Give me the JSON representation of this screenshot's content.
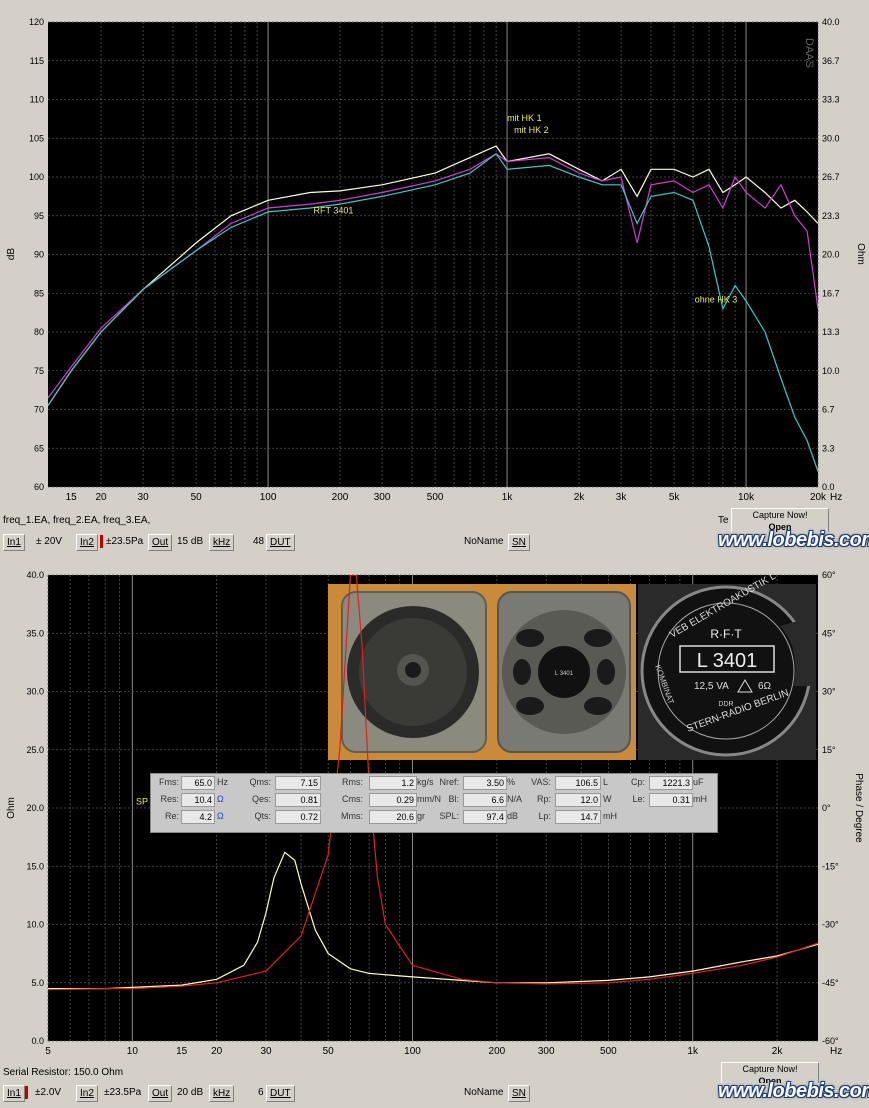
{
  "chart_data": [
    {
      "type": "line",
      "title": "",
      "xlabel": "Hz",
      "ylabel": "dB",
      "ylabel_right": "Ohm",
      "x_scale": "log",
      "xlim": [
        12,
        20000
      ],
      "ylim": [
        60,
        120
      ],
      "yticks": [
        "120",
        "115",
        "110",
        "105",
        "100",
        "95",
        "90",
        "85",
        "80",
        "75",
        "70",
        "65",
        "60"
      ],
      "yticks_right": [
        "40.0",
        "36.7",
        "33.3",
        "30.0",
        "26.7",
        "23.3",
        "20.0",
        "16.7",
        "13.3",
        "10.0",
        "6.7",
        "3.3",
        "0.0"
      ],
      "xtick_labels": [
        {
          "x": 15,
          "label": "15"
        },
        {
          "x": 20,
          "label": "20"
        },
        {
          "x": 30,
          "label": "30"
        },
        {
          "x": 50,
          "label": "50"
        },
        {
          "x": 100,
          "label": "100"
        },
        {
          "x": 200,
          "label": "200"
        },
        {
          "x": 300,
          "label": "300"
        },
        {
          "x": 500,
          "label": "500"
        },
        {
          "x": 1000,
          "label": "1k"
        },
        {
          "x": 2000,
          "label": "2k"
        },
        {
          "x": 3000,
          "label": "3k"
        },
        {
          "x": 5000,
          "label": "5k"
        },
        {
          "x": 10000,
          "label": "10k"
        },
        {
          "x": 20000,
          "label": "20k"
        }
      ],
      "grid": true,
      "watermark": "DAAS",
      "series": [
        {
          "color": "#ffffe0",
          "x": [
            12,
            15,
            20,
            30,
            50,
            70,
            100,
            150,
            200,
            300,
            500,
            700,
            900,
            1000,
            1500,
            2000,
            2500,
            3000,
            3500,
            4000,
            5000,
            6000,
            7000,
            8000,
            9000,
            10000,
            12000,
            14000,
            16000,
            18000,
            20000
          ],
          "y": [
            70.5,
            75,
            80,
            85.5,
            91.5,
            95,
            97,
            98,
            98.2,
            99,
            100.5,
            102.5,
            104,
            102,
            103,
            101,
            99.5,
            101,
            97.5,
            101,
            101,
            100,
            101,
            98,
            99,
            100,
            98,
            96,
            97,
            95.5,
            94
          ]
        },
        {
          "color": "#d040d0",
          "x": [
            12,
            15,
            20,
            30,
            50,
            70,
            100,
            150,
            200,
            300,
            500,
            700,
            900,
            1000,
            1500,
            2000,
            2500,
            3000,
            3500,
            4000,
            5000,
            6000,
            7000,
            8000,
            9000,
            10000,
            12000,
            14000,
            16000,
            18000,
            20000
          ],
          "y": [
            71.5,
            75.5,
            80.5,
            85.5,
            90.5,
            94,
            96,
            96.5,
            97,
            98,
            99.5,
            101,
            103,
            102,
            102.5,
            100.5,
            99.5,
            100,
            91.5,
            99,
            99.5,
            98,
            99,
            96,
            100,
            98,
            96,
            99,
            95,
            93,
            83
          ]
        },
        {
          "color": "#40c8c8",
          "x": [
            12,
            15,
            20,
            30,
            50,
            70,
            100,
            150,
            200,
            300,
            500,
            700,
            900,
            1000,
            1500,
            2000,
            2500,
            3000,
            3500,
            4000,
            5000,
            6000,
            7000,
            8000,
            9000,
            10000,
            12000,
            14000,
            16000,
            18000,
            20000
          ],
          "y": [
            70.5,
            75,
            80,
            85.5,
            90.5,
            93.5,
            95.5,
            96,
            96.5,
            97.5,
            99,
            100.5,
            103,
            101,
            101.5,
            100,
            99,
            99,
            94,
            97.5,
            98,
            97,
            91,
            83,
            86,
            84,
            80,
            74,
            69,
            66,
            62
          ]
        }
      ],
      "annotations": [
        {
          "text": "mit HK 1",
          "x": 1000,
          "y": 107.2
        },
        {
          "text": "mit HK 2",
          "x": 1070,
          "y": 105.7
        },
        {
          "text": "RFT 3401",
          "x": 155,
          "y": 95.3
        },
        {
          "text": "ohne HK 3",
          "x": 6100,
          "y": 83.8
        }
      ]
    },
    {
      "type": "line",
      "title": "",
      "xlabel": "Hz",
      "ylabel": "Ohm",
      "ylabel_right": "Phase / Degree",
      "x_scale": "log",
      "xlim": [
        5,
        2800
      ],
      "ylim": [
        0,
        40
      ],
      "yticks": [
        "40.0",
        "35.0",
        "30.0",
        "25.0",
        "20.0",
        "15.0",
        "10.0",
        "5.0",
        "0.0"
      ],
      "yticks_right": [
        "60°",
        "45°",
        "30°",
        "15°",
        "0°",
        "-15°",
        "-30°",
        "-45°",
        "-60°"
      ],
      "xtick_labels": [
        {
          "x": 5,
          "label": "5"
        },
        {
          "x": 10,
          "label": "10"
        },
        {
          "x": 15,
          "label": "15"
        },
        {
          "x": 20,
          "label": "20"
        },
        {
          "x": 30,
          "label": "30"
        },
        {
          "x": 50,
          "label": "50"
        },
        {
          "x": 100,
          "label": "100"
        },
        {
          "x": 200,
          "label": "200"
        },
        {
          "x": 300,
          "label": "300"
        },
        {
          "x": 500,
          "label": "500"
        },
        {
          "x": 1000,
          "label": "1k"
        },
        {
          "x": 2000,
          "label": "2k"
        }
      ],
      "grid": true,
      "series": [
        {
          "color": "#ffffc0",
          "x": [
            5,
            8,
            10,
            15,
            20,
            25,
            28,
            30,
            32,
            35,
            38,
            40,
            45,
            50,
            60,
            70,
            100,
            150,
            200,
            300,
            500,
            700,
            1000,
            1500,
            2000,
            2800
          ],
          "y": [
            4.5,
            4.5,
            4.6,
            4.8,
            5.3,
            6.5,
            8.5,
            11,
            14,
            16.2,
            15.5,
            13.5,
            9.5,
            7.5,
            6.2,
            5.8,
            5.5,
            5.2,
            5.0,
            5.0,
            5.2,
            5.5,
            6.0,
            6.8,
            7.3,
            8.3
          ]
        },
        {
          "color": "#e02020",
          "x": [
            5,
            8,
            10,
            15,
            20,
            30,
            40,
            50,
            55,
            58,
            60,
            63,
            66,
            70,
            75,
            80,
            100,
            150,
            200,
            300,
            500,
            700,
            1000,
            1500,
            2000,
            2800
          ],
          "y": [
            4.4,
            4.5,
            4.5,
            4.7,
            5.0,
            6.0,
            9.0,
            16,
            25,
            34,
            40,
            40,
            34,
            22,
            14,
            10,
            6.5,
            5.3,
            5.0,
            4.9,
            5.0,
            5.3,
            5.8,
            6.5,
            7.2,
            8.4
          ]
        }
      ],
      "annotations": [
        {
          "text": "SP 1",
          "x": 10.3,
          "y": 20.3
        }
      ]
    }
  ],
  "panel1": {
    "file_list": "freq_1.EA, freq_2.EA, freq_3.EA,",
    "te_label": "Te",
    "capture": {
      "line1": "Capture Now!",
      "line2": "Open"
    },
    "toolbar": {
      "in1": "In1",
      "range1": "± 20V",
      "in2": "In2",
      "range2": "±23.5Pa",
      "out": "Out",
      "db": "15 dB",
      "khz": "kHz",
      "num": "48",
      "dut": "DUT",
      "noname": "NoName",
      "sn": "SN"
    }
  },
  "panel2": {
    "status": "Serial Resistor: 150.0 Ohm",
    "capture": {
      "line1": "Capture Now!",
      "line2": "Open"
    },
    "toolbar": {
      "in1": "In1",
      "range1": "±2.0V",
      "in2": "In2",
      "range2": "±23.5Pa",
      "out": "Out",
      "db": "20 dB",
      "khz": "kHz",
      "num": "6",
      "dut": "DUT",
      "noname": "NoName",
      "sn": "SN"
    }
  },
  "brand": "www.lobebis.com",
  "photo_label": {
    "l1": "VEB ELEKTROAKUSTIK L",
    "l2": "R·F·T",
    "l3": "L 3401",
    "l4": "12,5 VA",
    "l5": "6Ω",
    "l6": "DDR",
    "l7": "KOMBINAT",
    "l8": "STERN-RADIO BERLIN",
    "l9": "L 3401"
  },
  "ts_params": {
    "fms_l": "Fms:",
    "fms_v": "65.0",
    "fms_u": "Hz",
    "res_l": "Res:",
    "res_v": "10.4",
    "res_u": "Ω",
    "re_l": "Re:",
    "re_v": "4.2",
    "re_u": "Ω",
    "qms_l": "Qms:",
    "qms_v": "7.15",
    "qes_l": "Qes:",
    "qes_v": "0.81",
    "qts_l": "Qts:",
    "qts_v": "0.72",
    "rms_l": "Rms:",
    "rms_v": "1.2",
    "rms_u": "kg/s",
    "cms_l": "Cms:",
    "cms_v": "0.29",
    "cms_u": "mm/N",
    "mms_l": "Mms:",
    "mms_v": "20.6",
    "mms_u": "gr",
    "nref_l": "Nref:",
    "nref_v": "3.50",
    "nref_u": "%",
    "bl_l": "Bl:",
    "bl_v": "6.6",
    "bl_u": "N/A",
    "spl_l": "SPL:",
    "spl_v": "97.4",
    "spl_u": "dB",
    "vas_l": "VAS:",
    "vas_v": "106.5",
    "vas_u": "L",
    "rp_l": "Rp:",
    "rp_v": "12.0",
    "rp_u": "W",
    "lp_l": "Lp:",
    "lp_v": "14.7",
    "lp_u": "mH",
    "cp_l": "Cp:",
    "cp_v": "1221.3",
    "cp_u": "uF",
    "le_l": "Le:",
    "le_v": "0.31",
    "le_u": "mH"
  }
}
